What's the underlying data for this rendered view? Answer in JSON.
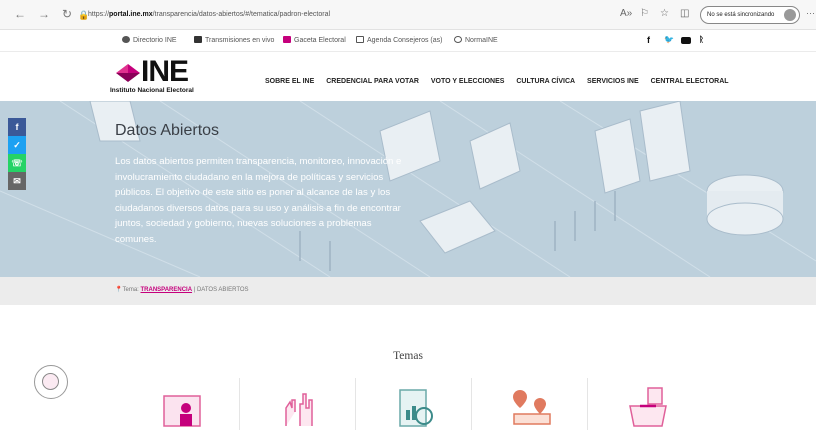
{
  "browser": {
    "url_prefix": "https://",
    "url_domain": "portal.ine.mx",
    "url_path": "/transparencia/datos-abiertos/#/tematica/padron-electoral",
    "sync_label": "No se está sincronizando"
  },
  "topbar": {
    "links": [
      "Directorio INE",
      "Transmisiones en vivo",
      "Gaceta Electoral",
      "Agenda Consejeros (as)",
      "NormaINE"
    ]
  },
  "logo": {
    "name": "INE",
    "subtitle": "Instituto Nacional Electoral"
  },
  "nav": {
    "items": [
      "SOBRE EL INE",
      "CREDENCIAL PARA VOTAR",
      "VOTO Y ELECCIONES",
      "CULTURA CÍVICA",
      "SERVICIOS INE",
      "CENTRAL ELECTORAL"
    ]
  },
  "hero": {
    "title": "Datos Abiertos",
    "text": "Los datos abiertos permiten transparencia, monitoreo, innovación e involucramiento ciudadano en la mejora de políticas y servicios públicos. El objetivo de este sitio es poner al alcance de las y los ciudadanos diversos datos para su uso y análisis a fin de encontrar juntos, sociedad y gobierno, nuevas soluciones a problemas comunes."
  },
  "social": [
    {
      "icon": "facebook-icon",
      "glyph": "f",
      "color": "#3b5998"
    },
    {
      "icon": "twitter-icon",
      "glyph": "t",
      "color": "#1da1f2"
    },
    {
      "icon": "whatsapp-icon",
      "glyph": "w",
      "color": "#25d366"
    },
    {
      "icon": "email-icon",
      "glyph": "m",
      "color": "#666666"
    }
  ],
  "breadcrumb": {
    "prefix": "Tema:",
    "current": "TRANSPARENCIA",
    "separator": "|",
    "section": "DATOS ABIERTOS"
  },
  "themes": {
    "title": "Temas"
  },
  "colors": {
    "accent": "#c5007c",
    "hero": "#bdd0dc"
  }
}
